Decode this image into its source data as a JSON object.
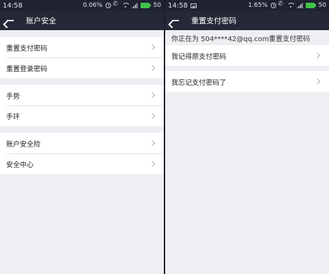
{
  "left": {
    "status": {
      "time": "14:58",
      "percent": "0.06%",
      "battery": "50"
    },
    "header": {
      "title": "账户安全"
    },
    "groups": [
      {
        "items": [
          {
            "label": "重置支付密码"
          },
          {
            "label": "重置登录密码"
          }
        ]
      },
      {
        "items": [
          {
            "label": "手势"
          },
          {
            "label": "手环"
          }
        ]
      },
      {
        "items": [
          {
            "label": "账户安全险"
          },
          {
            "label": "安全中心"
          }
        ]
      }
    ]
  },
  "right": {
    "status": {
      "time": "14:58",
      "percent": "1.65%",
      "battery": "50"
    },
    "header": {
      "title": "重置支付密码"
    },
    "notice": "你正在为 504****42@qq.com重置支付密码",
    "items": [
      {
        "label": "我记得原支付密码"
      },
      {
        "label": "我忘记支付密码了"
      }
    ]
  },
  "colors": {
    "header_bg": "#252836",
    "page_bg": "#eeeff3",
    "battery": "#3fc44a"
  },
  "icons": [
    "back-arrow-icon",
    "chevron-right-icon",
    "alarm-icon",
    "phone-icon",
    "wifi-icon",
    "signal-icon",
    "battery-icon",
    "image-icon"
  ]
}
